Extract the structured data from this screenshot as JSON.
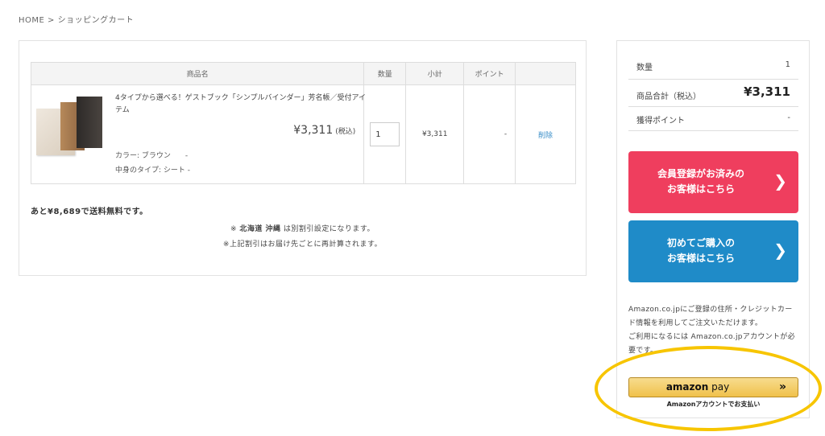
{
  "breadcrumb": "HOME > ショッピングカート",
  "table": {
    "headers": [
      "商品名",
      "数量",
      "小計",
      "ポイント",
      ""
    ],
    "rows": [
      {
        "name": "4タイプから選べる！ゲストブック「シンプルバインダー」芳名帳／受付アイテム",
        "price": "¥3,311",
        "price_tax": "(税込)",
        "option_color": "カラー: ブラウン　　-",
        "option_type": "中身のタイプ: シート -",
        "quantity": "1",
        "subtotal": "¥3,311",
        "points": "-",
        "delete_label": "削除"
      }
    ]
  },
  "free_shipping_msg": "あと¥8,689で送料無料です。",
  "note_shipping": {
    "prefix": "※ ",
    "regions": "北海道 沖縄",
    "suffix": " は別割引設定になります。"
  },
  "note_recalc": "※上記割引はお届け先ごとに再計算されます。",
  "summary": {
    "qty_label": "数量",
    "qty_value": "1",
    "total_label": "商品合計（税込）",
    "total_value": "¥3,311",
    "points_label": "獲得ポイント",
    "points_value": "-"
  },
  "cta_member": {
    "line1": "会員登録がお済みの",
    "line2": "お客様はこちら"
  },
  "cta_first": {
    "line1": "初めてご購入の",
    "line2": "お客様はこちら"
  },
  "amazon": {
    "desc1": "Amazon.co.jpにご登録の住所・クレジットカード情報を利用してご注文いただけます。",
    "desc2": "ご利用になるには Amazon.co.jpアカウントが必要です。",
    "btn_logo_bold": "amazon",
    "btn_logo_rest": " pay",
    "btn_sub": "Amazonアカウントでお支払い"
  },
  "colors": {
    "red_cta": "#ef3e5e",
    "blue_cta": "#1f8bc8",
    "highlight": "#f7c500",
    "link": "#3a8ec8"
  }
}
